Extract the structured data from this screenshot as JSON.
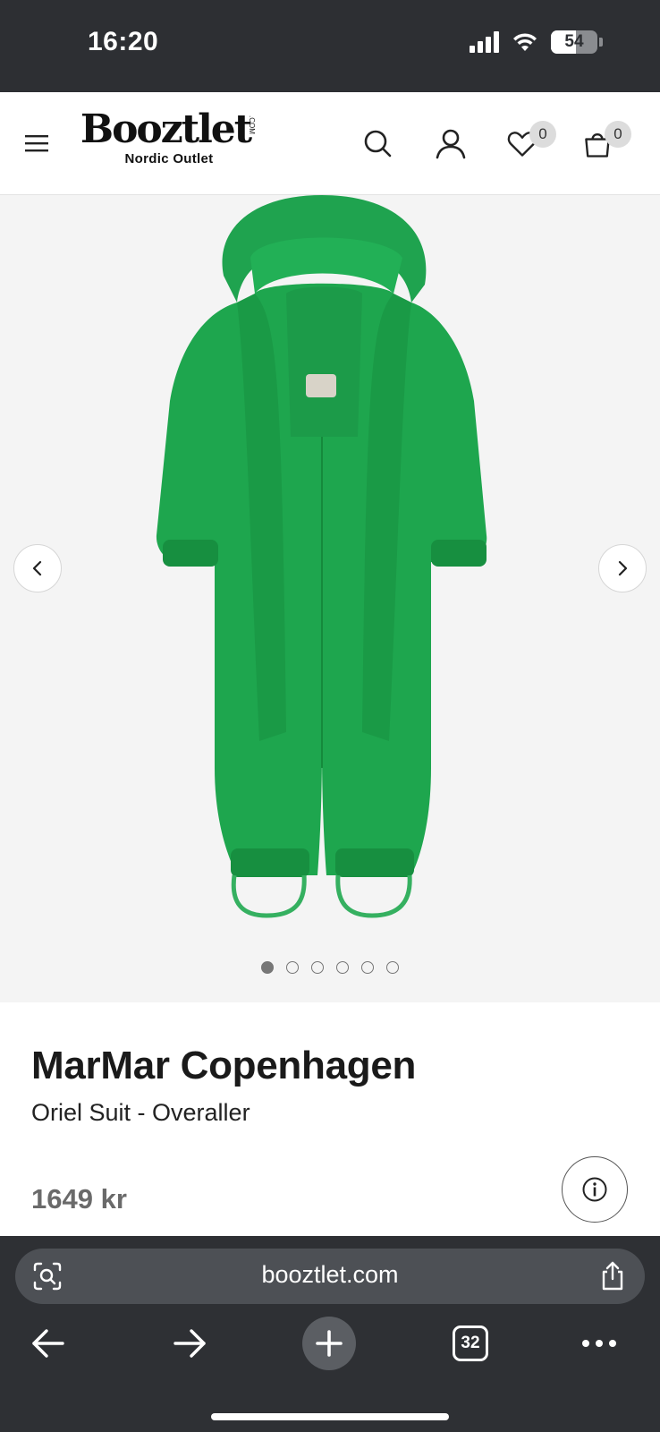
{
  "status_bar": {
    "time": "16:20",
    "battery_level": "54",
    "battery_fraction": 0.54,
    "icons": [
      "cellular-signal-icon",
      "wifi-icon",
      "battery-icon"
    ]
  },
  "header": {
    "logo_text": "Booztlet",
    "logo_suffix": ".COM",
    "logo_subtitle": "Nordic Outlet",
    "wishlist_count": "0",
    "cart_count": "0",
    "icons": [
      "hamburger-menu-icon",
      "search-icon",
      "account-icon",
      "heart-icon",
      "shopping-bag-icon"
    ]
  },
  "gallery": {
    "image_count": 6,
    "active_index": 0,
    "icons": [
      "chevron-left-icon",
      "chevron-right-icon"
    ],
    "product_color": "#1ea64e"
  },
  "product": {
    "brand": "MarMar Copenhagen",
    "name": "Oriel Suit - Overaller",
    "price": "1649 kr"
  },
  "browser": {
    "url": "booztlet.com",
    "tab_count": "32",
    "icons": [
      "visual-search-icon",
      "share-icon",
      "back-arrow-icon",
      "forward-arrow-icon",
      "plus-icon",
      "tabs-icon",
      "more-icon"
    ]
  },
  "colors": {
    "status_bar_bg": "#2d2f33",
    "gallery_bg": "#f4f4f4",
    "browser_bg": "#2e3034",
    "accent_green": "#1ea64e"
  }
}
